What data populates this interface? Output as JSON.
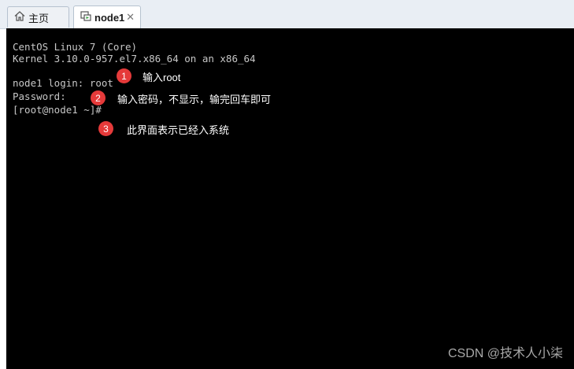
{
  "tabs": [
    {
      "label": "主页",
      "icon": "home-icon"
    },
    {
      "label": "node1",
      "icon": "vm-icon",
      "close": "✕"
    }
  ],
  "terminal": {
    "lines": [
      "CentOS Linux 7 (Core)",
      "Kernel 3.10.0-957.el7.x86_64 on an x86_64",
      "node1 login: root",
      "Password:",
      "[root@node1 ~]#"
    ]
  },
  "annotations": [
    {
      "number": "1",
      "text": "输入root"
    },
    {
      "number": "2",
      "text": "输入密码，不显示，输完回车即可"
    },
    {
      "number": "3",
      "text": "此界面表示已经入系统"
    }
  ],
  "colors": {
    "badge": "#e53a3a",
    "terminal_bg": "#000000",
    "terminal_text": "#c7c7c7"
  },
  "watermark": "CSDN @技术人小柒"
}
